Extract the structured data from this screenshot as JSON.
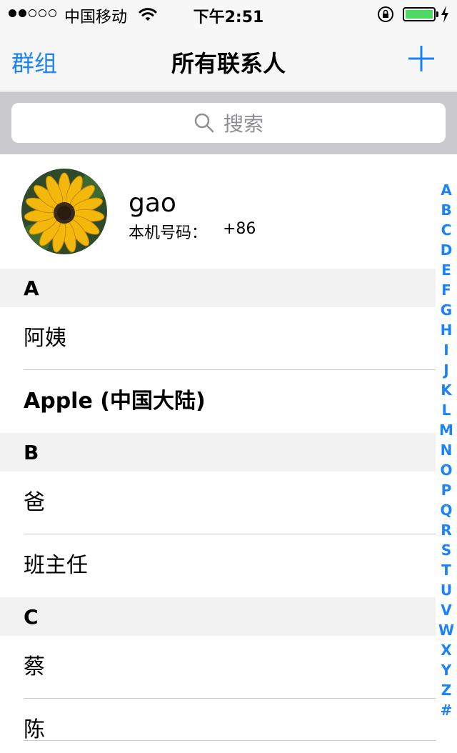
{
  "status_bar": {
    "signal_filled": 2,
    "signal_total": 5,
    "carrier": "中国移动",
    "time": "下午2:51",
    "battery_level": 1.0,
    "battery_color": "#4cd964"
  },
  "nav": {
    "left_label": "群组",
    "title": "所有联系人",
    "accent": "#1a82fb"
  },
  "search": {
    "placeholder": "搜索"
  },
  "my_card": {
    "name": "gao",
    "number_label": "本机号码：",
    "number": "+86"
  },
  "sections": [
    {
      "letter": "A",
      "contacts": [
        "阿姨",
        "Apple (中国大陆)"
      ]
    },
    {
      "letter": "B",
      "contacts": [
        "爸",
        "班主任"
      ]
    },
    {
      "letter": "C",
      "contacts": [
        "蔡",
        "陈"
      ]
    }
  ],
  "index_letters": [
    "A",
    "B",
    "C",
    "D",
    "E",
    "F",
    "G",
    "H",
    "I",
    "J",
    "K",
    "L",
    "M",
    "N",
    "O",
    "P",
    "Q",
    "R",
    "S",
    "T",
    "U",
    "V",
    "W",
    "X",
    "Y",
    "Z",
    "#"
  ]
}
